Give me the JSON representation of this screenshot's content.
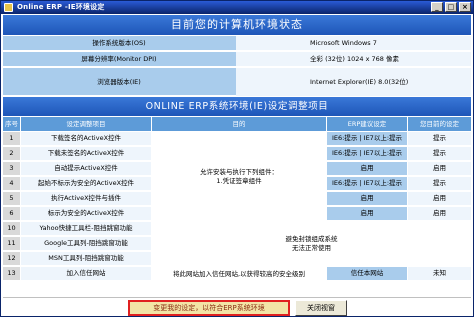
{
  "window": {
    "title": "Online ERP -IE环境设定"
  },
  "env": {
    "heading": "目前您的计算机环境状态",
    "rows": [
      {
        "label": "操作系统版本(OS)",
        "value": "Microsoft Windows 7"
      },
      {
        "label": "屏幕分辨率(Monitor DPI)",
        "value": "全彩 (32位)  1024 x 768 像素"
      },
      {
        "label": "浏览器版本(IE)",
        "value": "Internet Explorer(IE) 8.0(32位)"
      }
    ]
  },
  "settings": {
    "heading": "ONLINE ERP系统环境(IE)设定调整项目",
    "columns": [
      "序号",
      "设定调整项目",
      "目的",
      "ERP建议设定",
      "您目前的设定"
    ],
    "purpose_groups": [
      {
        "lines": [
          "允许安装与执行下列组件：",
          "1.凭证签章组件"
        ]
      },
      {
        "lines": [
          "避免封锁组成系统",
          "无法正常使用"
        ]
      },
      {
        "lines": [
          "将此网站加入信任网站,以获得较高的安全级别"
        ]
      }
    ],
    "rows": [
      {
        "no": "1",
        "item": "下载签名的ActiveX控件",
        "recommend": "IE6:提示 | IE7以上:提示",
        "current": "提示"
      },
      {
        "no": "2",
        "item": "下载未签名的ActiveX控件",
        "recommend": "IE6:提示 | IE7以上:提示",
        "current": "提示"
      },
      {
        "no": "3",
        "item": "自动提示ActiveX控件",
        "recommend": "启用",
        "current": "启用"
      },
      {
        "no": "4",
        "item": "起始不标示为安全的ActiveX控件",
        "recommend": "IE6:提示 | IE7以上:提示",
        "current": "提示"
      },
      {
        "no": "5",
        "item": "执行ActiveX控件与插件",
        "recommend": "启用",
        "current": "启用"
      },
      {
        "no": "6",
        "item": "标示为安全的ActiveX控件",
        "recommend": "启用",
        "current": "启用"
      },
      {
        "no": "10",
        "item": "Yahoo快捷工具栏-阻挡跳窗功能",
        "recommend": "",
        "current": ""
      },
      {
        "no": "11",
        "item": "Google工具列-阻挡跳窗功能",
        "recommend": "",
        "current": ""
      },
      {
        "no": "12",
        "item": "MSN工具列-阻挡跳窗功能",
        "recommend": "",
        "current": ""
      },
      {
        "no": "13",
        "item": "加入信任网站",
        "recommend": "信任本网站",
        "current": "未知"
      }
    ]
  },
  "footer": {
    "apply_label": "变更我的设定，以符合ERP系统环境",
    "close_label": "关闭视窗"
  }
}
